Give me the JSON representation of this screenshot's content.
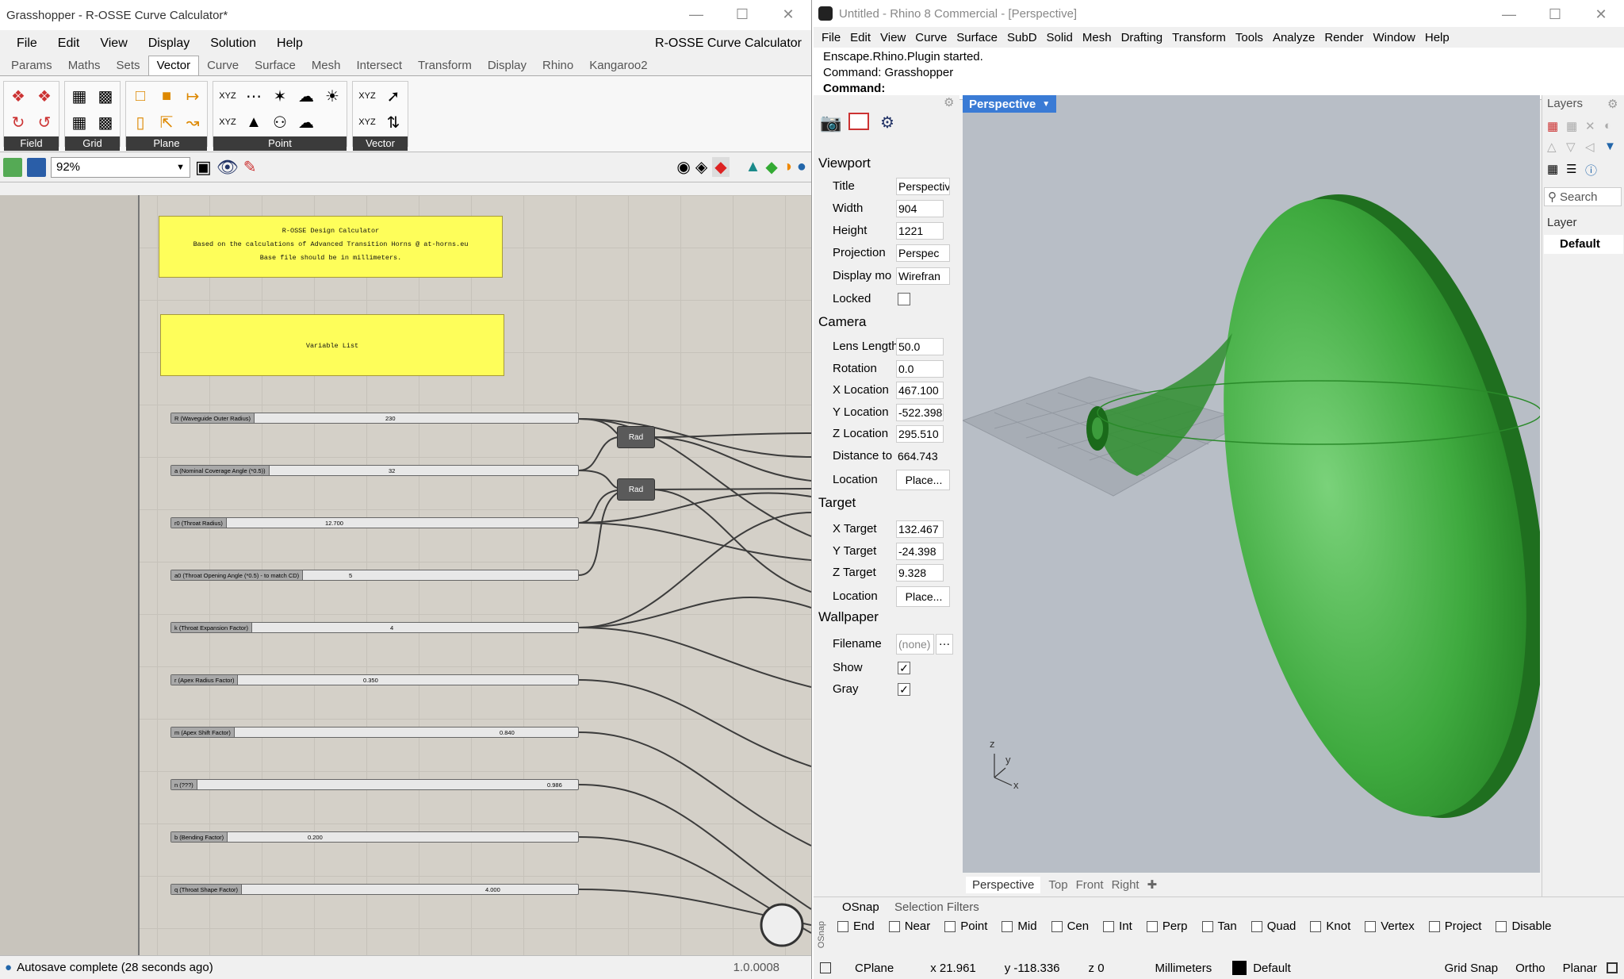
{
  "grasshopper": {
    "title": "Grasshopper - R-OSSE Curve Calculator*",
    "menu": [
      "File",
      "Edit",
      "View",
      "Display",
      "Solution",
      "Help"
    ],
    "doc_name": "R-OSSE Curve Calculator",
    "tabs": [
      "Params",
      "Maths",
      "Sets",
      "Vector",
      "Curve",
      "Surface",
      "Mesh",
      "Intersect",
      "Transform",
      "Display",
      "Rhino",
      "Kangaroo2"
    ],
    "ribbon_groups": [
      "Field",
      "Grid",
      "Plane",
      "Point",
      "Vector"
    ],
    "zoom": "92%",
    "panels": {
      "header_title": "R-OSSE Design Calculator",
      "header_line2": "Based on the calculations of Advanced Transition Horns @ at-horns.eu",
      "header_line3": "Base file should be in millimeters.",
      "variable_list": "Variable List"
    },
    "sliders": [
      {
        "name": "R (Waveguide Outer Radius)",
        "value": "230"
      },
      {
        "name": "a (Nominal Coverage Angle (*0.5))",
        "value": "32"
      },
      {
        "name": "r0 (Throat Radius)",
        "value": "12.700"
      },
      {
        "name": "a0 (Throat Opening Angle (*0.5) - to match CD)",
        "value": "5"
      },
      {
        "name": "k (Throat Expansion Factor)",
        "value": "4"
      },
      {
        "name": "r (Apex Radius Factor)",
        "value": "0.350"
      },
      {
        "name": "m (Apex Shift Factor)",
        "value": "0.840"
      },
      {
        "name": "n (???)",
        "value": "0.986"
      },
      {
        "name": "b (Bending Factor)",
        "value": "0.200"
      },
      {
        "name": "q (Throat Shape Factor)",
        "value": "4.000"
      }
    ],
    "rad_label": "Rad",
    "status": "Autosave complete (28 seconds ago)",
    "version": "1.0.0008"
  },
  "rhino": {
    "title": "Untitled - Rhino 8 Commercial - [Perspective]",
    "menu": [
      "File",
      "Edit",
      "View",
      "Curve",
      "Surface",
      "SubD",
      "Solid",
      "Mesh",
      "Drafting",
      "Transform",
      "Tools",
      "Analyze",
      "Render",
      "Window",
      "Help"
    ],
    "cmd_line1": "Enscape.Rhino.Plugin started.",
    "cmd_line2": "Command: Grasshopper",
    "cmd_prompt": "Command:",
    "props": {
      "viewport_section": "Viewport",
      "title_label": "Title",
      "title_value": "Perspective",
      "width_label": "Width",
      "width_value": "904",
      "height_label": "Height",
      "height_value": "1221",
      "projection_label": "Projection",
      "projection_value": "Perspec",
      "display_label": "Display mo",
      "display_value": "Wirefran",
      "locked_label": "Locked",
      "camera_section": "Camera",
      "lens_label": "Lens Length",
      "lens_value": "50.0",
      "rotation_label": "Rotation",
      "rotation_value": "0.0",
      "xloc_label": "X Location",
      "xloc_value": "467.100",
      "yloc_label": "Y Location",
      "yloc_value": "-522.398",
      "zloc_label": "Z Location",
      "zloc_value": "295.510",
      "dist_label": "Distance to",
      "dist_value": "664.743",
      "location_label": "Location",
      "place_button": "Place...",
      "target_section": "Target",
      "xt_label": "X Target",
      "xt_value": "132.467",
      "yt_label": "Y Target",
      "yt_value": "-24.398",
      "zt_label": "Z Target",
      "zt_value": "9.328",
      "location2_label": "Location",
      "place_button2": "Place...",
      "wallpaper_section": "Wallpaper",
      "filename_label": "Filename",
      "filename_value": "(none)",
      "show_label": "Show",
      "gray_label": "Gray"
    },
    "viewport_label": "Perspective",
    "view_tabs": [
      "Perspective",
      "Top",
      "Front",
      "Right"
    ],
    "layers": {
      "title": "Layers",
      "search": "Search",
      "header": "Layer",
      "default": "Default"
    },
    "osnap_tabs": [
      "OSnap",
      "Selection Filters"
    ],
    "osnap_items": [
      "End",
      "Near",
      "Point",
      "Mid",
      "Cen",
      "Int",
      "Perp",
      "Tan",
      "Quad",
      "Knot",
      "Vertex",
      "Project",
      "Disable"
    ],
    "status": {
      "cplane": "CPlane",
      "x": "x 21.961",
      "y": "y -118.336",
      "z": "z 0",
      "units": "Millimeters",
      "layer": "Default",
      "grid_snap": "Grid Snap",
      "ortho": "Ortho",
      "planar": "Planar"
    }
  },
  "colors": {
    "panel_yellow": "#fefe5a",
    "horn_green": "#3faa3f",
    "viewport_bg": "#b8bec6",
    "accent_blue": "#3a7bd5"
  }
}
